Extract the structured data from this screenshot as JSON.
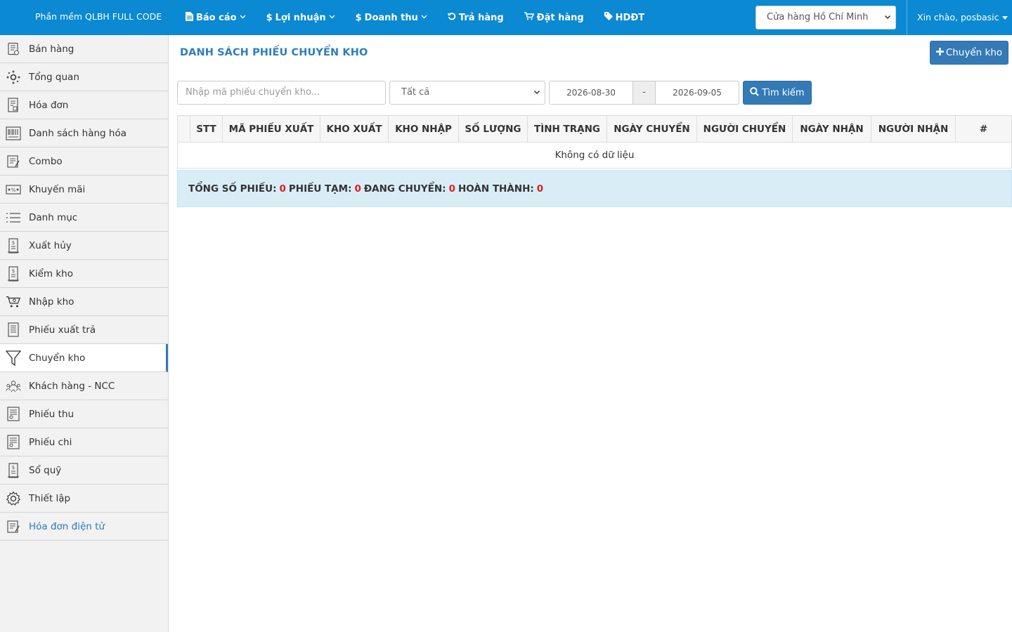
{
  "header": {
    "brand": "Phần mềm QLBH FULL CODE",
    "nav": [
      {
        "label": "Báo cáo",
        "icon": "file-icon",
        "has_caret": true
      },
      {
        "label": "Lợi nhuận",
        "icon": "dollar-icon",
        "has_caret": true
      },
      {
        "label": "Doanh thu",
        "icon": "dollar-icon",
        "has_caret": true
      },
      {
        "label": "Trả hàng",
        "icon": "undo-icon",
        "has_caret": false
      },
      {
        "label": "Đặt hàng",
        "icon": "cart-icon",
        "has_caret": false
      },
      {
        "label": "HDĐT",
        "icon": "tag-icon",
        "has_caret": false
      }
    ],
    "store_select": "Cửa hàng Hồ Chí Minh",
    "user_greeting": "Xin chào, posbasic"
  },
  "sidebar": {
    "items": [
      {
        "label": "Bán hàng",
        "icon": "sales-icon"
      },
      {
        "label": "Tổng quan",
        "icon": "overview-icon"
      },
      {
        "label": "Hóa đơn",
        "icon": "invoice-icon"
      },
      {
        "label": "Danh sách hàng hóa",
        "icon": "barcode-icon"
      },
      {
        "label": "Combo",
        "icon": "combo-icon"
      },
      {
        "label": "Khuyến mãi",
        "icon": "promotion-icon"
      },
      {
        "label": "Danh mục",
        "icon": "list-icon"
      },
      {
        "label": "Xuất hủy",
        "icon": "ledger-icon"
      },
      {
        "label": "Kiểm kho",
        "icon": "ledger-icon"
      },
      {
        "label": "Nhập kho",
        "icon": "cart-icon"
      },
      {
        "label": "Phiếu xuất trả",
        "icon": "return-icon"
      },
      {
        "label": "Chuyển kho",
        "icon": "filter-icon"
      },
      {
        "label": "Khách hàng - NCC",
        "icon": "customers-icon"
      },
      {
        "label": "Phiếu thu",
        "icon": "receipt-icon"
      },
      {
        "label": "Phiếu chi",
        "icon": "receipt-icon"
      },
      {
        "label": "Sổ quỹ",
        "icon": "ledger-icon"
      },
      {
        "label": "Thiết lập",
        "icon": "gear-icon"
      },
      {
        "label": "Hóa đơn điện tử",
        "icon": "einvoice-icon"
      }
    ],
    "active_index": 11,
    "link_index": 17
  },
  "main": {
    "title": "DANH SÁCH PHIẾU CHUYỂN KHO",
    "add_button": "Chuyển kho",
    "filters": {
      "search_placeholder": "Nhập mã phiếu chuyển kho...",
      "status_value": "Tất cả",
      "date_from": "2026-08-30",
      "date_sep": "-",
      "date_to": "2026-09-05",
      "search_button": "Tìm kiếm"
    },
    "table": {
      "columns": [
        "",
        "STT",
        "MÃ PHIẾU XUẤT",
        "KHO XUẤT",
        "KHO NHẬP",
        "SỐ LƯỢNG",
        "TÌNH TRẠNG",
        "NGÀY CHUYỂN",
        "NGƯỜI CHUYỂN",
        "NGÀY NHẬN",
        "NGƯỜI NHẬN",
        "#"
      ],
      "empty_text": "Không có dữ liệu"
    },
    "summary": {
      "total_label": "TỔNG SỐ PHIẾU:",
      "total": "0",
      "draft_label": "PHIẾU TẠM:",
      "draft": "0",
      "transit_label": "ĐANG CHUYỂN:",
      "transit": "0",
      "done_label": "HOÀN THÀNH:",
      "done": "0"
    }
  }
}
